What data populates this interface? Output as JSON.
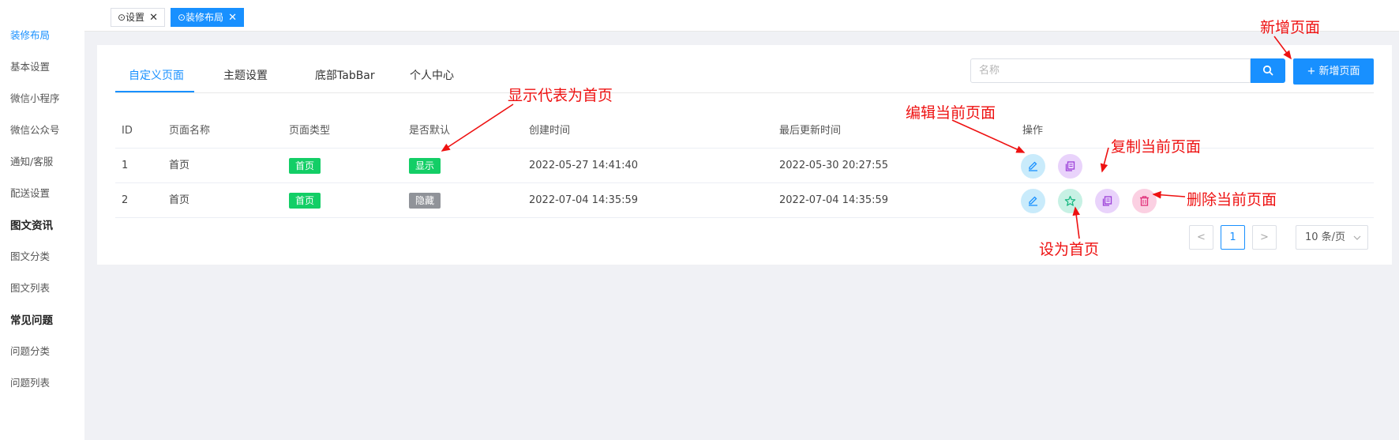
{
  "sidebar": {
    "items": [
      {
        "label": "装修布局",
        "state": "active"
      },
      {
        "label": "基本设置"
      },
      {
        "label": "微信小程序"
      },
      {
        "label": "微信公众号"
      },
      {
        "label": "通知/客服"
      },
      {
        "label": "配送设置"
      },
      {
        "label": "图文资讯",
        "type": "group"
      },
      {
        "label": "图文分类"
      },
      {
        "label": "图文列表"
      },
      {
        "label": "常见问题",
        "type": "group"
      },
      {
        "label": "问题分类"
      },
      {
        "label": "问题列表"
      }
    ]
  },
  "tabbar": {
    "tags": [
      {
        "label": "⊙设置",
        "close": "✕"
      },
      {
        "label": "⊙装修布局",
        "close": "✕",
        "state": "active"
      }
    ]
  },
  "tabs": [
    {
      "label": "自定义页面",
      "state": "active"
    },
    {
      "label": "主题设置"
    },
    {
      "label": "底部TabBar"
    },
    {
      "label": "个人中心"
    }
  ],
  "search": {
    "placeholder": "名称",
    "button_icon": "search-icon"
  },
  "add_button": {
    "label": "+ 新增页面"
  },
  "table": {
    "headers": [
      "ID",
      "页面名称",
      "页面类型",
      "是否默认",
      "创建时间",
      "最后更新时间",
      "操作"
    ],
    "rows": [
      {
        "id": "1",
        "name": "首页",
        "type": "首页",
        "default": "显示",
        "default_state": "shown",
        "created": "2022-05-27 14:41:40",
        "updated": "2022-05-30 20:27:55",
        "actions": [
          "edit-icon",
          "copy-icon"
        ]
      },
      {
        "id": "2",
        "name": "首页",
        "type": "首页",
        "default": "隐藏",
        "default_state": "hidden",
        "created": "2022-07-04 14:35:59",
        "updated": "2022-07-04 14:35:59",
        "actions": [
          "edit-icon",
          "star-icon",
          "copy-icon",
          "trash-icon"
        ]
      }
    ]
  },
  "pagination": {
    "prev": "<",
    "current": "1",
    "next": ">",
    "page_size": "10 条/页"
  },
  "annotations": {
    "add_page": "新增页面",
    "show_home": "显示代表为首页",
    "edit_page": "编辑当前页面",
    "copy_page": "复制当前页面",
    "delete_page": "删除当前页面",
    "set_home": "设为首页"
  },
  "colors": {
    "accent": "#1890ff",
    "badge_green": "#13ce66",
    "badge_gray": "#909399",
    "annotation_red": "#ee1111"
  }
}
